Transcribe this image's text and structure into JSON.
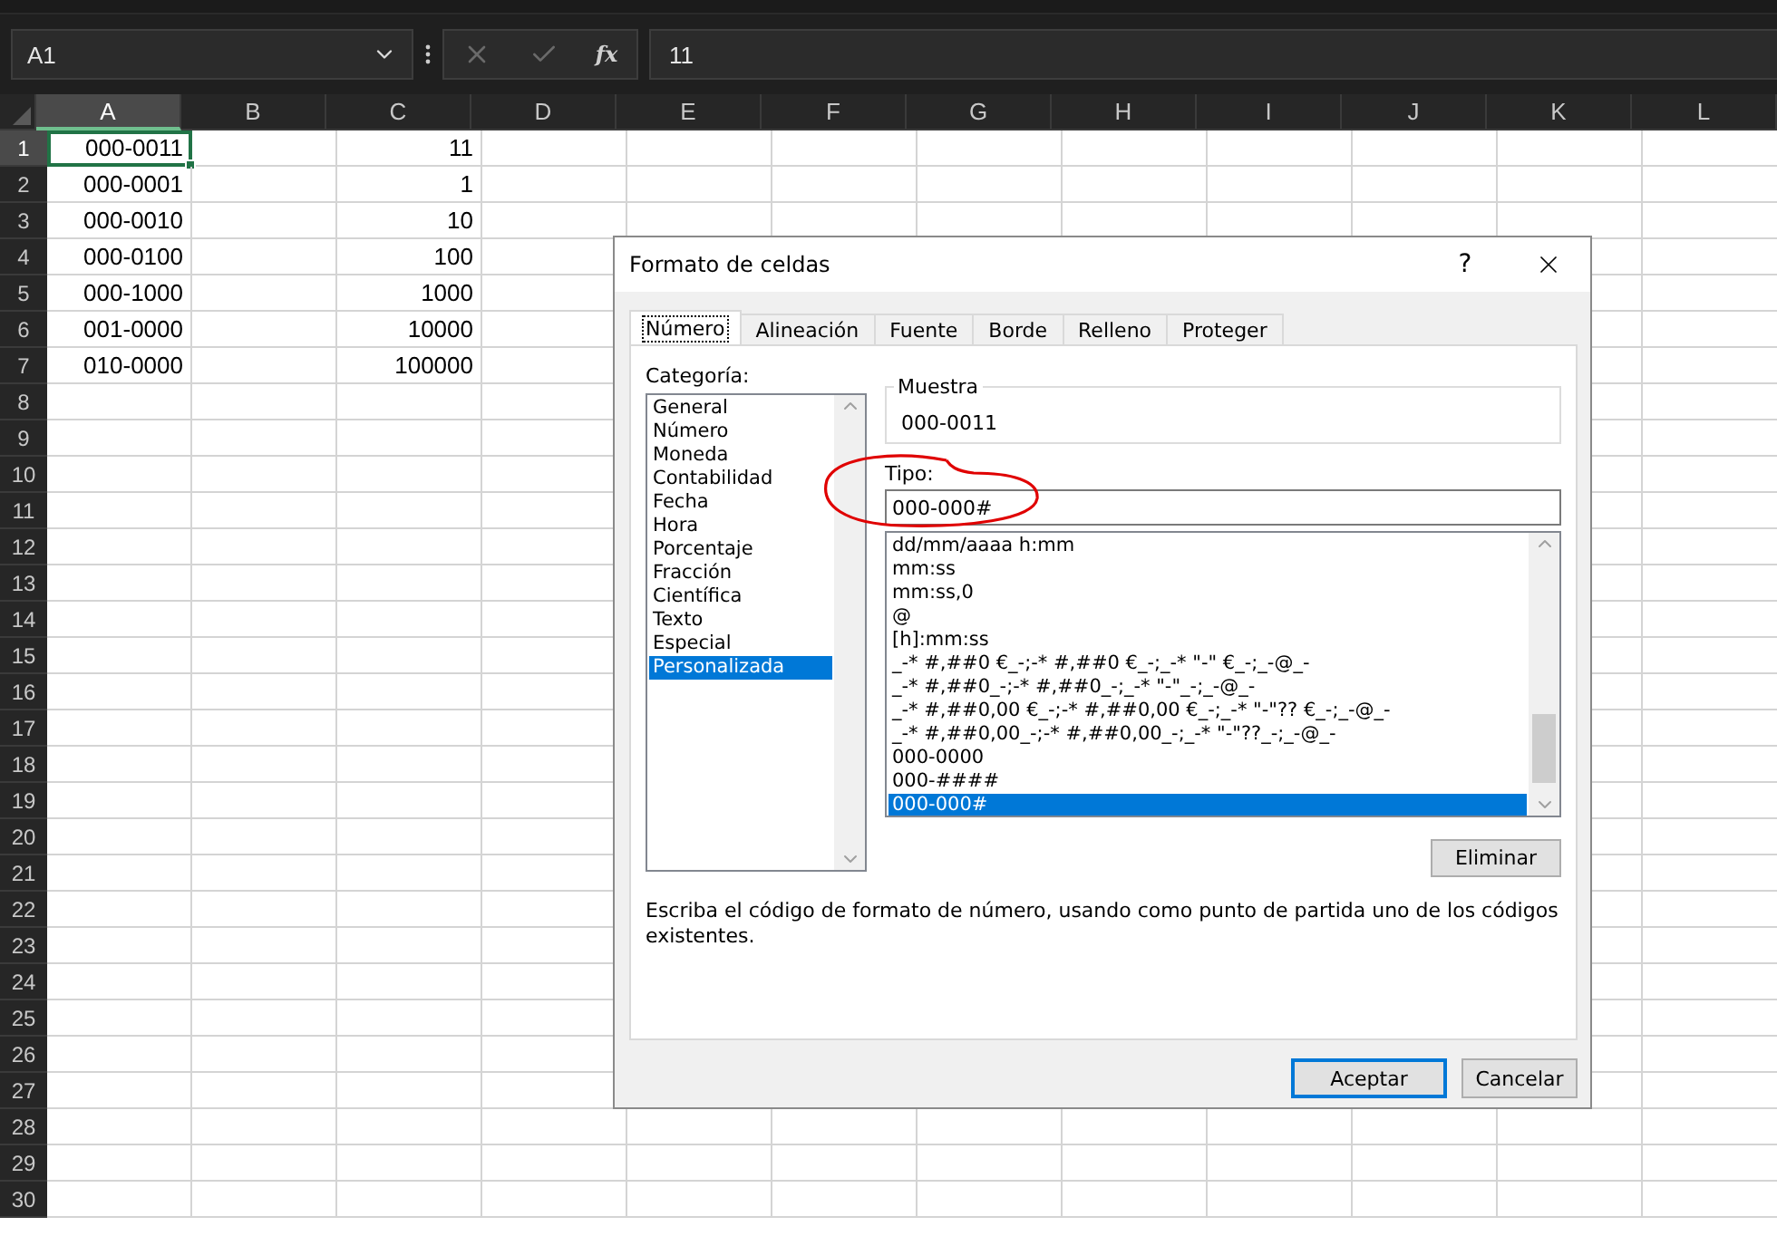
{
  "formula_bar": {
    "name_box": "A1",
    "function_button": "fx",
    "formula": "11"
  },
  "sheet": {
    "columns": [
      {
        "label": "A",
        "selected": true
      },
      {
        "label": "B",
        "selected": false
      },
      {
        "label": "C",
        "selected": false
      },
      {
        "label": "D",
        "selected": false
      },
      {
        "label": "E",
        "selected": false
      },
      {
        "label": "F",
        "selected": false
      },
      {
        "label": "G",
        "selected": false
      },
      {
        "label": "H",
        "selected": false
      },
      {
        "label": "I",
        "selected": false
      },
      {
        "label": "J",
        "selected": false
      },
      {
        "label": "K",
        "selected": false
      },
      {
        "label": "L",
        "selected": false
      }
    ],
    "rows": [
      {
        "number": "1",
        "selected": true,
        "cells": [
          {
            "text": "000-0011",
            "selected": true
          },
          null,
          {
            "text": "11",
            "selected": false
          }
        ]
      },
      {
        "number": "2",
        "selected": false,
        "cells": [
          {
            "text": "000-0001",
            "selected": false
          },
          null,
          {
            "text": "1",
            "selected": false
          }
        ]
      },
      {
        "number": "3",
        "selected": false,
        "cells": [
          {
            "text": "000-0010",
            "selected": false
          },
          null,
          {
            "text": "10",
            "selected": false
          }
        ]
      },
      {
        "number": "4",
        "selected": false,
        "cells": [
          {
            "text": "000-0100",
            "selected": false
          },
          null,
          {
            "text": "100",
            "selected": false
          }
        ]
      },
      {
        "number": "5",
        "selected": false,
        "cells": [
          {
            "text": "000-1000",
            "selected": false
          },
          null,
          {
            "text": "1000",
            "selected": false
          }
        ]
      },
      {
        "number": "6",
        "selected": false,
        "cells": [
          {
            "text": "001-0000",
            "selected": false
          },
          null,
          {
            "text": "10000",
            "selected": false
          }
        ]
      },
      {
        "number": "7",
        "selected": false,
        "cells": [
          {
            "text": "010-0000",
            "selected": false
          },
          null,
          {
            "text": "100000",
            "selected": false
          }
        ]
      },
      {
        "number": "8",
        "selected": false
      },
      {
        "number": "9",
        "selected": false
      },
      {
        "number": "10",
        "selected": false
      },
      {
        "number": "11",
        "selected": false
      },
      {
        "number": "12",
        "selected": false
      },
      {
        "number": "13",
        "selected": false
      },
      {
        "number": "14",
        "selected": false
      },
      {
        "number": "15",
        "selected": false
      },
      {
        "number": "16",
        "selected": false
      },
      {
        "number": "17",
        "selected": false
      },
      {
        "number": "18",
        "selected": false
      },
      {
        "number": "19",
        "selected": false
      },
      {
        "number": "20",
        "selected": false
      },
      {
        "number": "21",
        "selected": false
      },
      {
        "number": "22",
        "selected": false
      },
      {
        "number": "23",
        "selected": false
      },
      {
        "number": "24",
        "selected": false
      },
      {
        "number": "25",
        "selected": false
      },
      {
        "number": "26",
        "selected": false
      },
      {
        "number": "27",
        "selected": false
      },
      {
        "number": "28",
        "selected": false
      },
      {
        "number": "29",
        "selected": false
      },
      {
        "number": "30",
        "selected": false
      }
    ]
  },
  "dialog": {
    "title": "Formato de celdas",
    "help": "?",
    "tabs": [
      {
        "label": "Número",
        "selected": true
      },
      {
        "label": "Alineación",
        "selected": false
      },
      {
        "label": "Fuente",
        "selected": false
      },
      {
        "label": "Borde",
        "selected": false
      },
      {
        "label": "Relleno",
        "selected": false
      },
      {
        "label": "Proteger",
        "selected": false
      }
    ],
    "category_label": "Categoría:",
    "categories": [
      {
        "label": "General",
        "selected": false
      },
      {
        "label": "Número",
        "selected": false
      },
      {
        "label": "Moneda",
        "selected": false
      },
      {
        "label": "Contabilidad",
        "selected": false
      },
      {
        "label": "Fecha",
        "selected": false
      },
      {
        "label": "Hora",
        "selected": false
      },
      {
        "label": "Porcentaje",
        "selected": false
      },
      {
        "label": "Fracción",
        "selected": false
      },
      {
        "label": "Científica",
        "selected": false
      },
      {
        "label": "Texto",
        "selected": false
      },
      {
        "label": "Especial",
        "selected": false
      },
      {
        "label": "Personalizada",
        "selected": true
      }
    ],
    "sample_label": "Muestra",
    "sample": "000-0011",
    "type_label": "Tipo:",
    "type_value": "000-000#",
    "type_list": [
      {
        "label": "dd/mm/aaaa h:mm",
        "selected": false
      },
      {
        "label": "mm:ss",
        "selected": false
      },
      {
        "label": "mm:ss,0",
        "selected": false
      },
      {
        "label": "@",
        "selected": false
      },
      {
        "label": "[h]:mm:ss",
        "selected": false
      },
      {
        "label": "_-* #,##0 €_-;-* #,##0 €_-;_-* \"-\" €_-;_-@_-",
        "selected": false
      },
      {
        "label": "_-* #,##0_-;-* #,##0_-;_-* \"-\"_-;_-@_-",
        "selected": false
      },
      {
        "label": "_-* #,##0,00 €_-;-* #,##0,00 €_-;_-* \"-\"?? €_-;_-@_-",
        "selected": false
      },
      {
        "label": "_-* #,##0,00_-;-* #,##0,00_-;_-* \"-\"??_-;_-@_-",
        "selected": false
      },
      {
        "label": "000-0000",
        "selected": false
      },
      {
        "label": "000-####",
        "selected": false
      },
      {
        "label": "000-000#",
        "selected": true
      }
    ],
    "delete_button": "Eliminar",
    "description": "Escriba el código de formato de número, usando como punto de partida uno de los códigos existentes.",
    "buttons": [
      {
        "label": "Aceptar",
        "selected": true
      },
      {
        "label": "Cancelar",
        "selected": false
      }
    ]
  }
}
